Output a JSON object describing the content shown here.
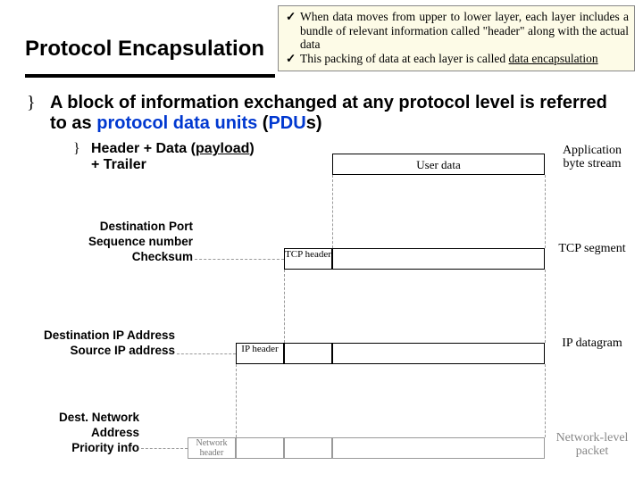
{
  "title": "Protocol Encapsulation",
  "tips": {
    "t1a": "When data moves from upper to lower layer, each layer includes a bundle of relevant information called \"header\" along with the actual data",
    "t2a": "This packing of data at each layer is called ",
    "t2b": "data encapsulation"
  },
  "main": {
    "a": "A block of information exchanged at any protocol level is referred to as ",
    "b": "protocol data units",
    "c": " (",
    "d": "PDU",
    "e": "s)"
  },
  "sub": {
    "a": "Header + Data (",
    "b": "payload",
    "c": ") + Trailer"
  },
  "rows": {
    "r1": {
      "seg": "User data",
      "label": "Application byte stream"
    },
    "r2": {
      "hdr": "TCP header",
      "label": "TCP segment"
    },
    "r3": {
      "hdr": "IP header",
      "label": "IP datagram"
    },
    "r4": {
      "hdr": "Network header",
      "label": "Network-level packet"
    }
  },
  "ann": {
    "a2": {
      "l1": "Destination Port",
      "l2": "Sequence number",
      "l3": "Checksum"
    },
    "a3": {
      "l1": "Destination IP Address",
      "l2": "Source IP address"
    },
    "a4": {
      "l1": "Dest. Network",
      "l2": "Address",
      "l3": "Priority info"
    }
  }
}
